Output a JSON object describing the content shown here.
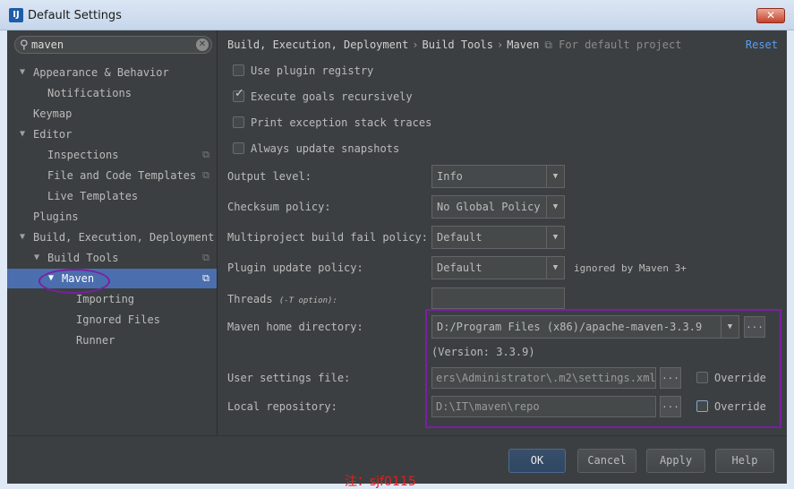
{
  "window": {
    "title": "Default Settings",
    "app_icon_text": "IJ",
    "close_glyph": "✕"
  },
  "sidebar": {
    "search_value": "maven",
    "items": [
      {
        "label": "Appearance & Behavior",
        "arrow": "▼"
      },
      {
        "label": "Notifications"
      },
      {
        "label": "Keymap"
      },
      {
        "label": "Editor",
        "arrow": "▼"
      },
      {
        "label": "Inspections"
      },
      {
        "label": "File and Code Templates"
      },
      {
        "label": "Live Templates"
      },
      {
        "label": "Plugins"
      },
      {
        "label": "Build, Execution, Deployment",
        "arrow": "▼"
      },
      {
        "label": "Build Tools",
        "arrow": "▼"
      },
      {
        "label": "Maven",
        "arrow": "▼"
      },
      {
        "label": "Importing"
      },
      {
        "label": "Ignored Files"
      },
      {
        "label": "Runner"
      }
    ]
  },
  "breadcrumb": {
    "parts": [
      "Build, Execution, Deployment",
      "Build Tools",
      "Maven"
    ],
    "separator": "›",
    "note": "For default project",
    "reset": "Reset"
  },
  "options": {
    "use_plugin_registry": {
      "label": "Use plugin registry",
      "checked": false
    },
    "execute_goals_recursively": {
      "label": "Execute goals recursively",
      "checked": true
    },
    "print_exception_stack_traces": {
      "label": "Print exception stack traces",
      "checked": false
    },
    "always_update_snapshots": {
      "label": "Always update snapshots",
      "checked": false
    }
  },
  "form": {
    "output_level": {
      "label": "Output level:",
      "value": "Info"
    },
    "checksum_policy": {
      "label": "Checksum policy:",
      "value": "No Global Policy"
    },
    "multiproject_fail_policy": {
      "label": "Multiproject build fail policy:",
      "value": "Default"
    },
    "plugin_update_policy": {
      "label": "Plugin update policy:",
      "value": "Default",
      "hint": "ignored by Maven 3+"
    },
    "threads": {
      "label": "Threads",
      "hint": "(-T option):",
      "value": ""
    },
    "maven_home": {
      "label": "Maven home directory:",
      "value": "D:/Program Files (x86)/apache-maven-3.3.9",
      "version": "(Version: 3.3.9)"
    },
    "user_settings": {
      "label": "User settings file:",
      "value": "ers\\Administrator\\.m2\\settings.xml",
      "override": "Override",
      "override_checked": false
    },
    "local_repo": {
      "label": "Local repository:",
      "value": "D:\\IT\\maven\\repo",
      "override": "Override",
      "override_checked": false
    },
    "browse_glyph": "...",
    "dropdown_glyph": "▼"
  },
  "buttons": {
    "ok": "OK",
    "cancel": "Cancel",
    "apply": "Apply",
    "help": "Help"
  },
  "watermark": "注：sjf0115",
  "colors": {
    "selection": "#4b6eaf",
    "link": "#589df6",
    "annotation": "#7b1fa2",
    "watermark": "#e02020"
  }
}
